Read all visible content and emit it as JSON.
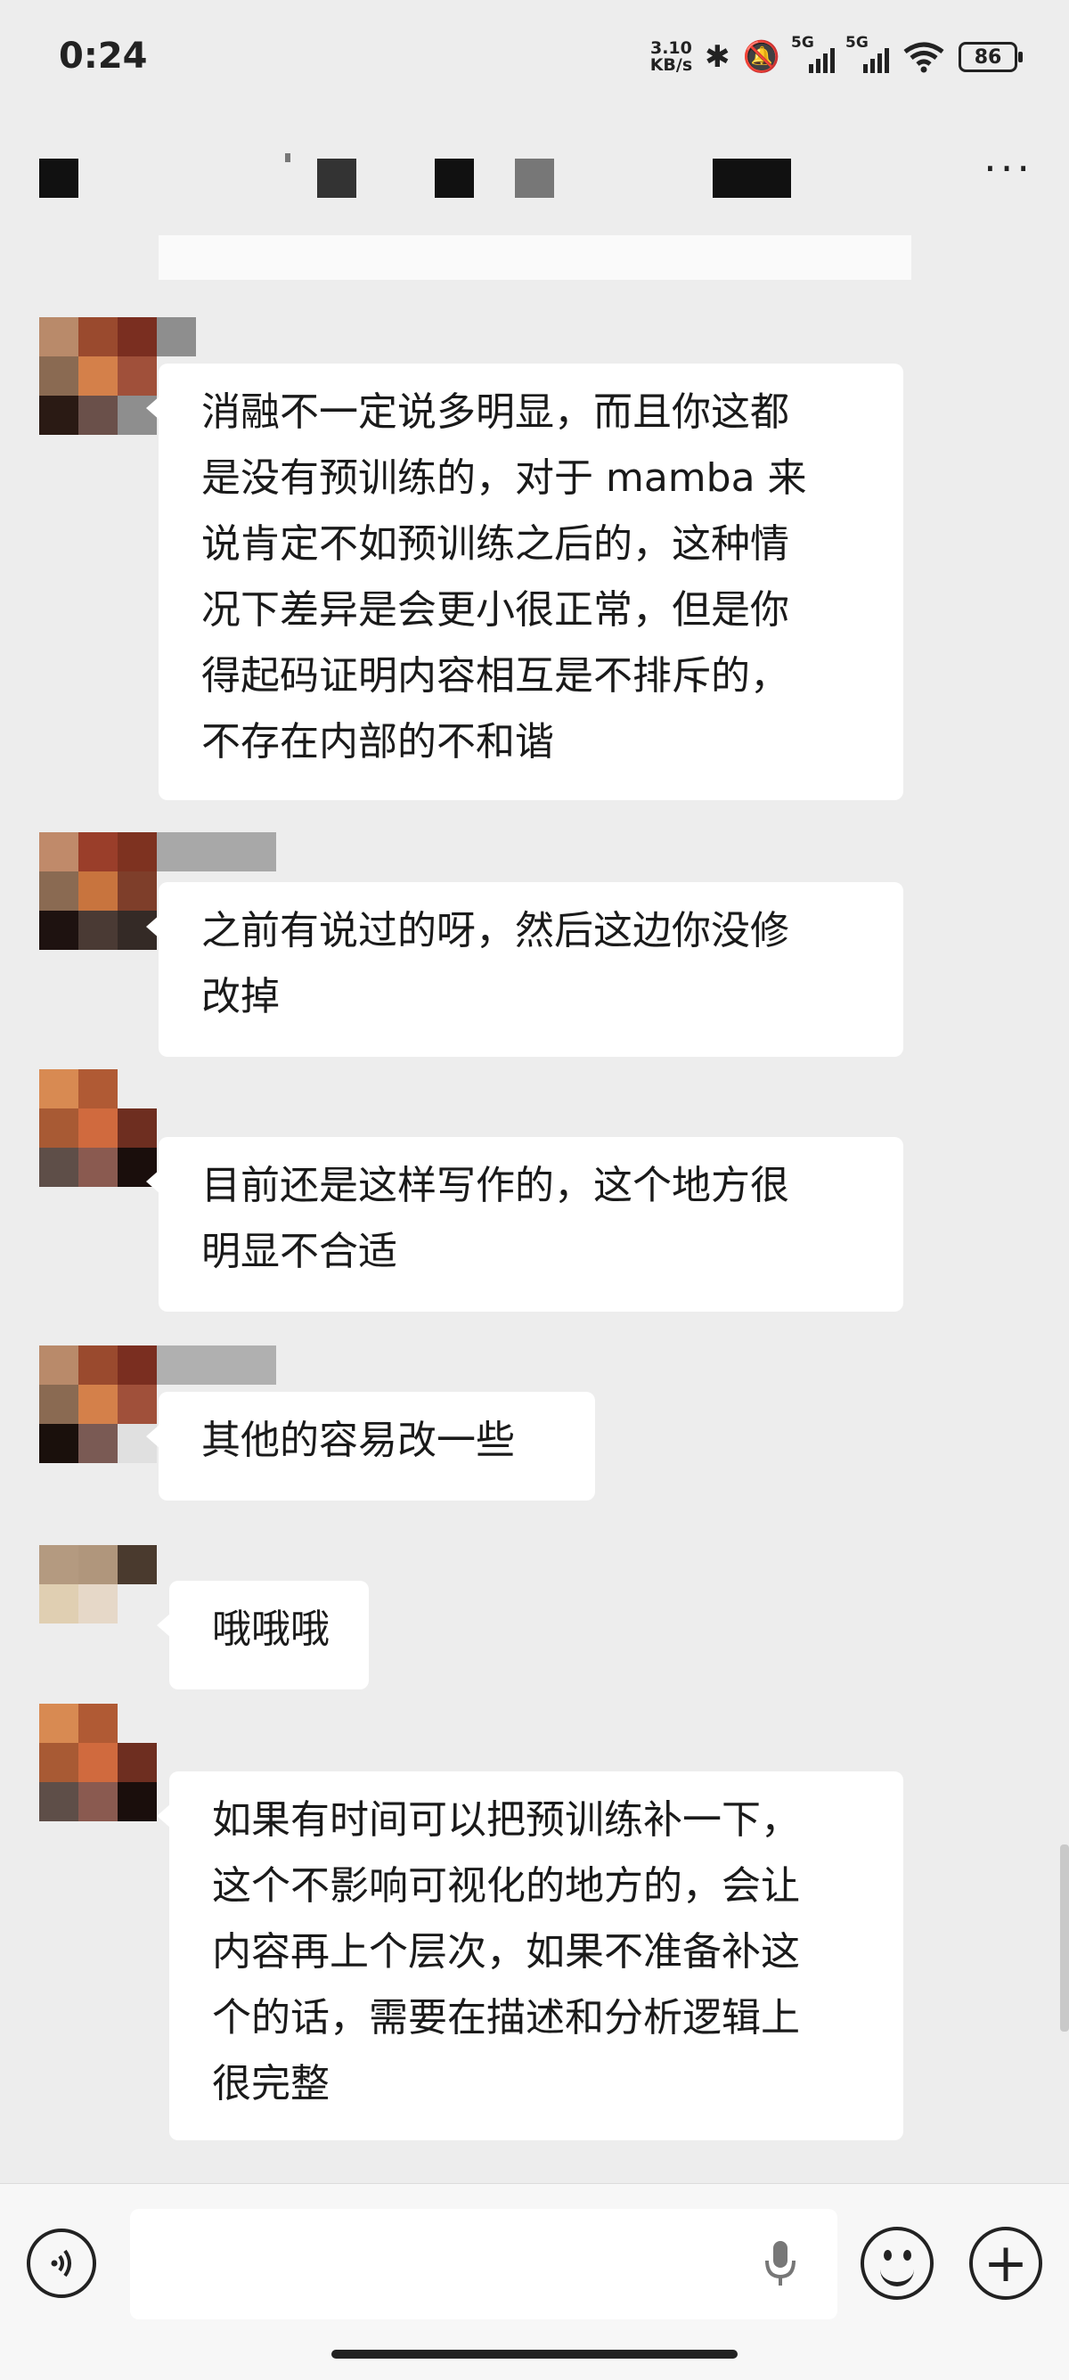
{
  "status_bar": {
    "time": "0:24",
    "net_speed": "3.10\nKB/s",
    "sim1": "5G",
    "sim2": "5G",
    "battery": "86"
  },
  "header": {
    "more_label": "···"
  },
  "messages": [
    {
      "text": "消融不一定说多明显，而且你这都\n是没有预训练的，对于 mamba 来\n说肯定不如预训练之后的，这种情\n况下差异是会更小很正常，但是你\n得起码证明内容相互是不排斥的，\n不存在内部的不和谐"
    },
    {
      "text": "之前有说过的呀，然后这边你没修\n改掉"
    },
    {
      "text": "目前还是这样写作的，这个地方很\n明显不合适"
    },
    {
      "text": "其他的容易改一些"
    },
    {
      "text": "哦哦哦"
    },
    {
      "text": "如果有时间可以把预训练补一下，\n这个不影响可视化的地方的，会让\n内容再上个层次，如果不准备补这\n个的话，需要在描述和分析逻辑上\n很完整"
    }
  ],
  "input_bar": {
    "placeholder": ""
  },
  "colors": {
    "background": "#ededed",
    "bubble": "#ffffff",
    "avatar_a": "#c07a4a",
    "avatar_b": "#8a8a8a"
  }
}
